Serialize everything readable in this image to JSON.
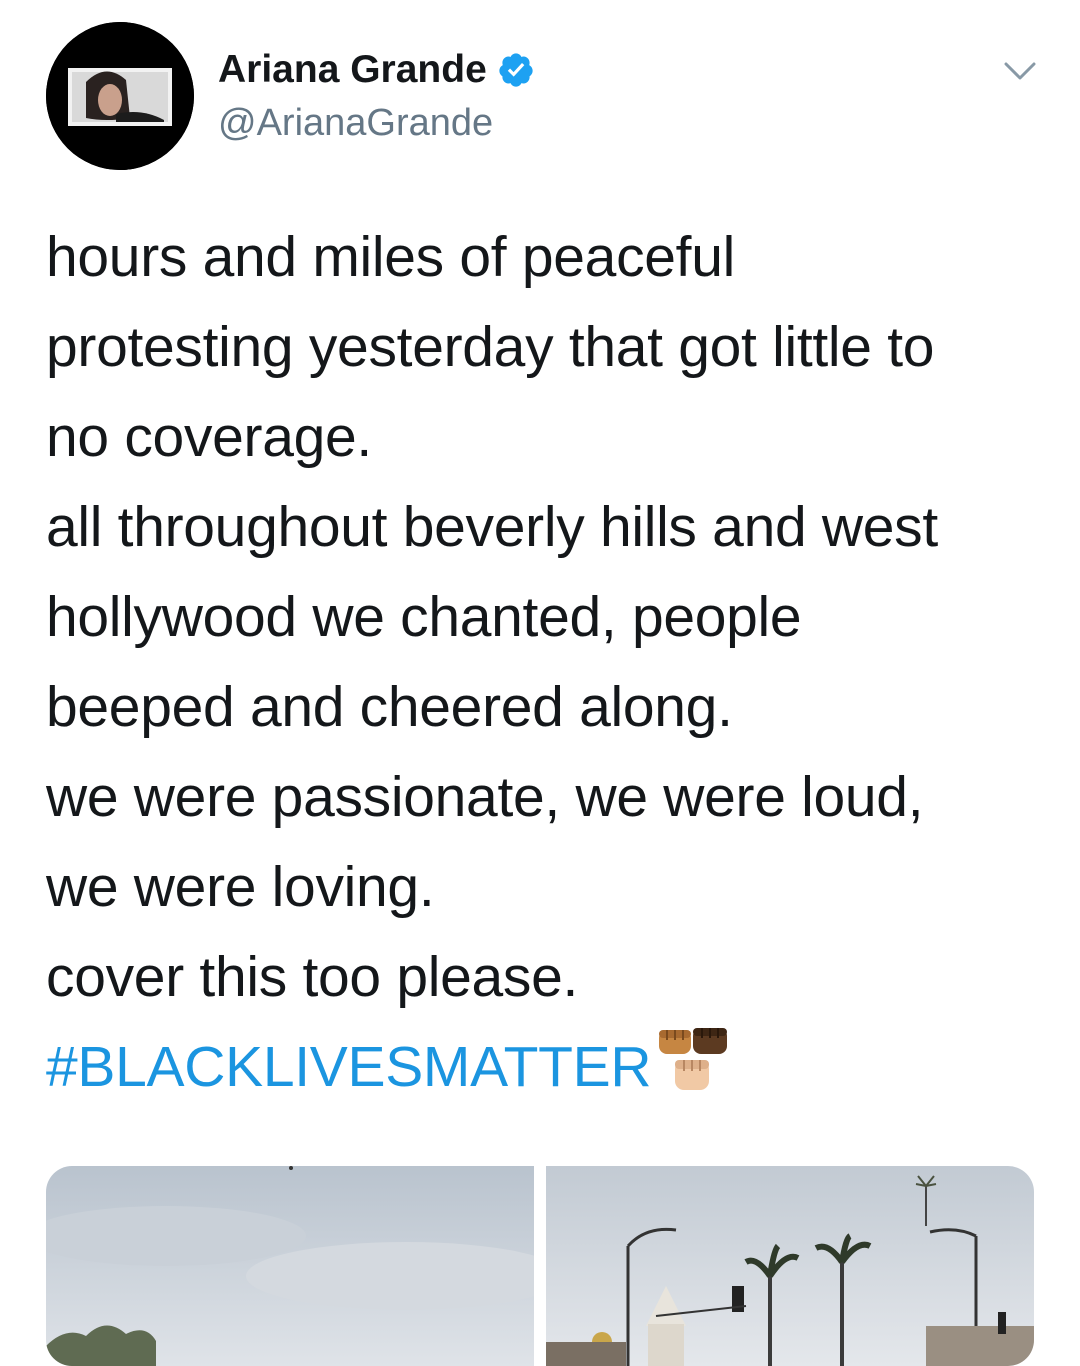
{
  "tweet": {
    "author": {
      "display_name": "Ariana Grande",
      "handle": "@ArianaGrande",
      "verified": true,
      "avatar_icon": "profile-avatar"
    },
    "menu_icon": "chevron-down-icon",
    "text_lines": [
      "hours and miles of peaceful",
      "protesting yesterday that got little to",
      "no coverage.",
      "all throughout beverly hills and west",
      "hollywood we chanted, people",
      "beeped and cheered along.",
      "we were passionate, we were loud,",
      "we were loving.",
      "cover this too please."
    ],
    "hashtag": "#BLACKLIVESMATTER",
    "hashtag_emoji_icon": "raised-fists-emoji-icon",
    "media": [
      {
        "icon": "photo-protest-cloudy-sky"
      },
      {
        "icon": "photo-street-palm-trees-church"
      }
    ]
  },
  "colors": {
    "text": "#14171a",
    "secondary": "#657786",
    "link": "#1b95e0",
    "verified": "#1da1f2",
    "background": "#ffffff"
  }
}
